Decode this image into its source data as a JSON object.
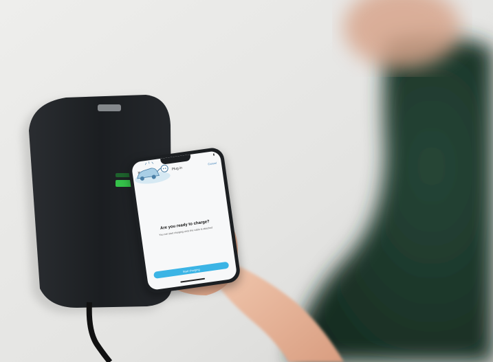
{
  "phone": {
    "status_time": "",
    "nav_title": "Plug in",
    "nav_cancel": "Cancel",
    "nav_close_icon": "close-icon",
    "illustration_icon": "car-charger-plug-icon",
    "headline": "Are you ready to charge?",
    "body": "You can start charging once the cable is attached",
    "cta_label": "Start charging"
  },
  "colors": {
    "wall": "#e9e9e7",
    "charger": "#1e2124",
    "charger_led": "#35c24a",
    "cta": "#3bb4e5",
    "shirt": "#1f3a2e"
  }
}
